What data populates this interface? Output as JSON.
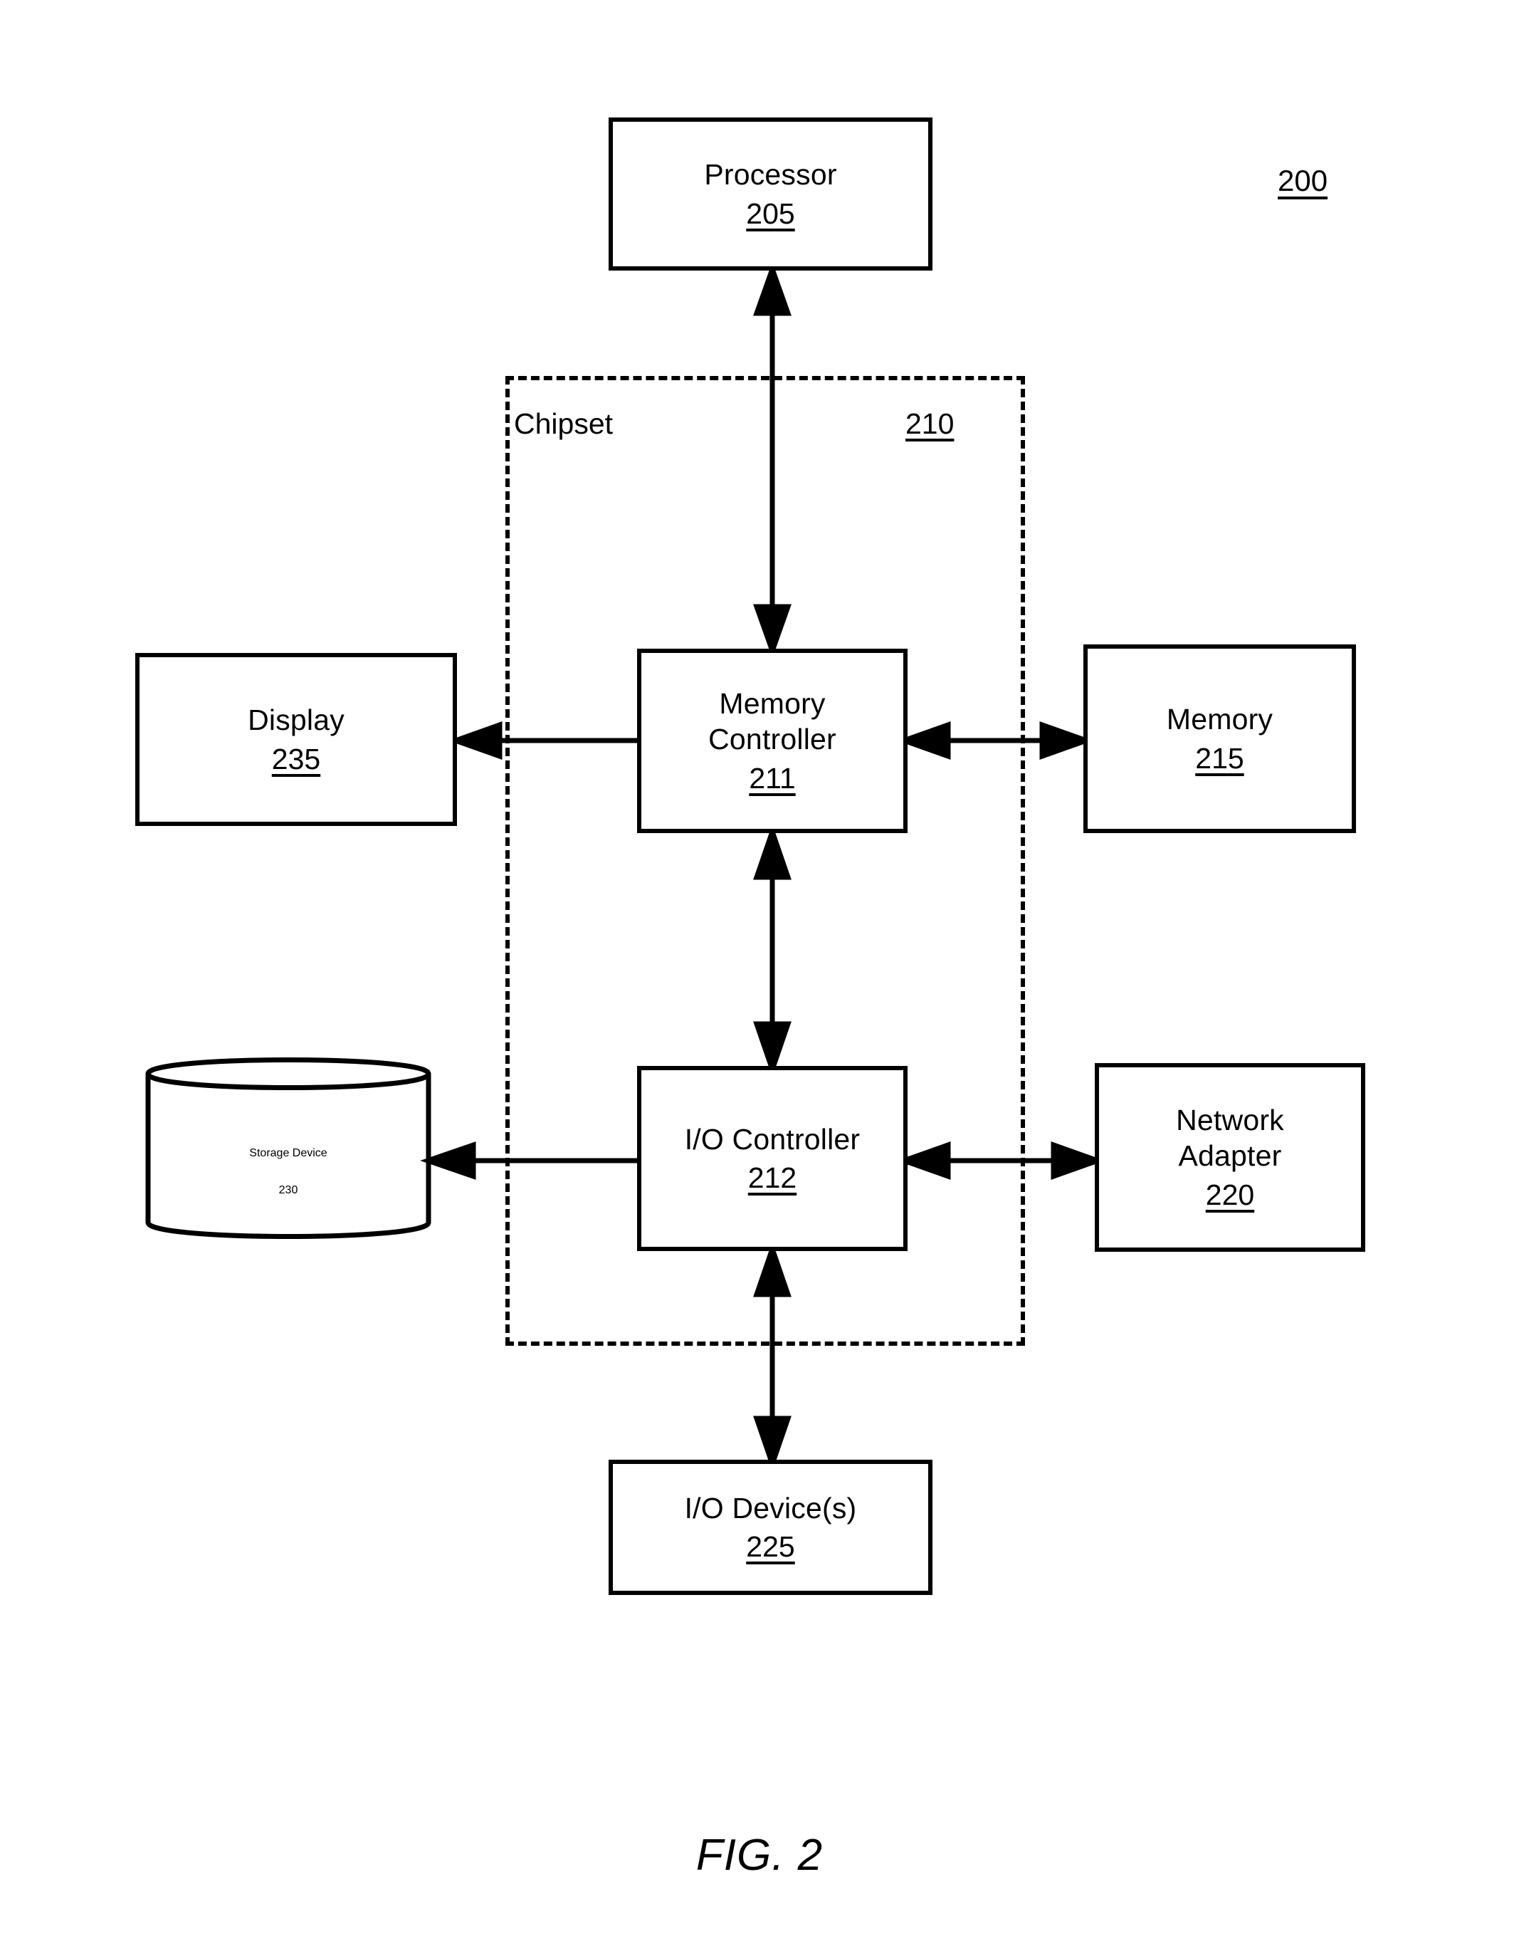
{
  "figure": {
    "caption": "FIG. 2",
    "reference_number": "200"
  },
  "chipset": {
    "label": "Chipset",
    "reference_number": "210"
  },
  "nodes": {
    "processor": {
      "label": "Processor",
      "reference_number": "205",
      "shape": "rectangle"
    },
    "memory_controller": {
      "label_line1": "Memory",
      "label_line2": "Controller",
      "reference_number": "211",
      "shape": "rectangle"
    },
    "io_controller": {
      "label": "I/O Controller",
      "reference_number": "212",
      "shape": "rectangle"
    },
    "display": {
      "label": "Display",
      "reference_number": "235",
      "shape": "rectangle"
    },
    "memory": {
      "label": "Memory",
      "reference_number": "215",
      "shape": "rectangle"
    },
    "storage_device": {
      "label": "Storage Device",
      "reference_number": "230",
      "shape": "cylinder"
    },
    "network_adapter": {
      "label_line1": "Network",
      "label_line2": "Adapter",
      "reference_number": "220",
      "shape": "rectangle"
    },
    "io_devices": {
      "label": "I/O Device(s)",
      "reference_number": "225",
      "shape": "rectangle"
    }
  },
  "connections": [
    {
      "from": "processor",
      "to": "memory_controller",
      "orientation": "vertical",
      "arrowheads": "both"
    },
    {
      "from": "display",
      "to": "memory_controller",
      "orientation": "horizontal",
      "arrowheads": "both"
    },
    {
      "from": "memory_controller",
      "to": "memory",
      "orientation": "horizontal",
      "arrowheads": "both"
    },
    {
      "from": "memory_controller",
      "to": "io_controller",
      "orientation": "vertical",
      "arrowheads": "both"
    },
    {
      "from": "storage_device",
      "to": "io_controller",
      "orientation": "horizontal",
      "arrowheads": "both"
    },
    {
      "from": "io_controller",
      "to": "network_adapter",
      "orientation": "horizontal",
      "arrowheads": "both"
    },
    {
      "from": "io_controller",
      "to": "io_devices",
      "orientation": "vertical",
      "arrowheads": "both"
    }
  ],
  "colors": {
    "stroke": "#000000",
    "background": "#ffffff"
  }
}
